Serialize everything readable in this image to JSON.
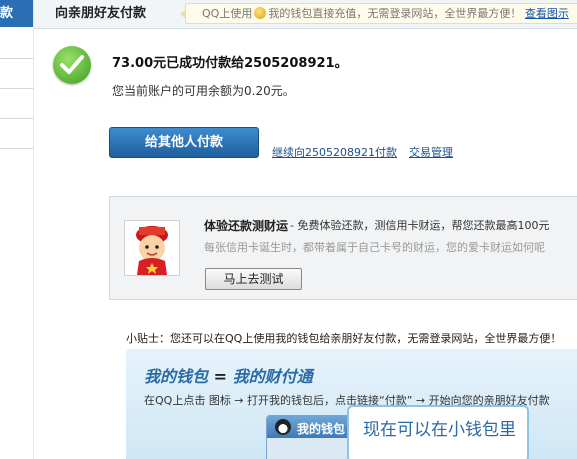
{
  "sidebar": {
    "head_label": "款"
  },
  "header": {
    "title": "向亲朋好友付款",
    "notice_before": "QQ上使用",
    "notice_after": "我的钱包直接充值，无需登录网站，全世界最方便！",
    "notice_link": "查看图示"
  },
  "result": {
    "message": "73.00元已成功付款给2505208921。",
    "balance": "您当前账户的可用余额为0.20元。"
  },
  "actions": {
    "pay_others": "给其他人付款",
    "continue_pay": "继续向2505208921付款",
    "transactions": "交易管理"
  },
  "promo": {
    "title": "体验还款测财运",
    "desc": "- 免费体验还款，测信用卡财运，帮您还款最高100元",
    "sub": "每张信用卡诞生时，都带着属于自己卡号的财运，您的爱卡财运如何呢",
    "button": "马上去测试"
  },
  "tip": "小贴士：您还可以在QQ上使用我的钱包给亲朋好友付款，无需登录网站，全世界最方便！",
  "banner": {
    "title_a": "我的钱包",
    "title_eq": "=",
    "title_b": "我的财付通",
    "step_line": "在QQ上点击 图标 → 打开我的钱包后，点击链接“付款” → 开始向您的亲朋好友付款",
    "window_title": "我的钱包",
    "bubble": "现在可以在小钱包里"
  },
  "colors": {
    "accent_blue": "#2a6fb3",
    "button_blue": "#1f5f9d",
    "link": "#1b4f8c",
    "success_green": "#3a9d1e"
  },
  "icons": {
    "success": "check-circle-icon",
    "coin": "qq-wallet-coin-icon",
    "avatar": "fortune-god-avatar",
    "penguin": "qq-penguin-icon"
  }
}
